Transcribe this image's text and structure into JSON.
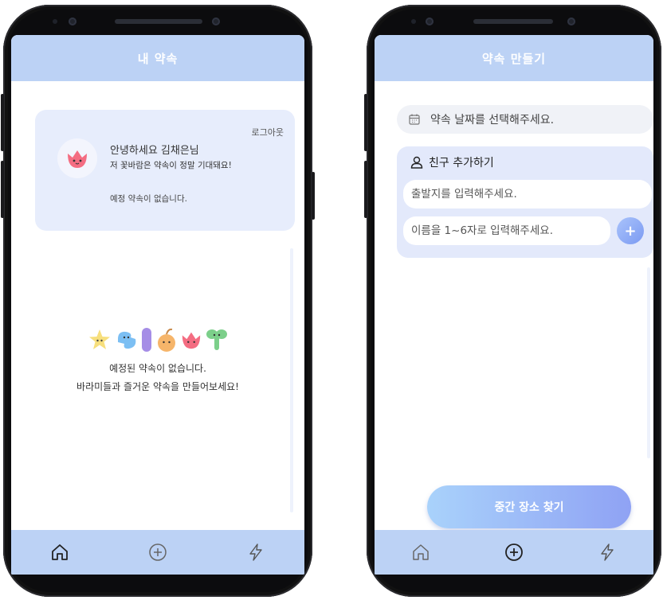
{
  "colors": {
    "header": "#bcd2f5",
    "card": "#e7edfc",
    "accent": "#8fa2f4",
    "phone_body": "#0c0c0e"
  },
  "home": {
    "title": "내 약속",
    "logout": "로그아웃",
    "greeting": "안녕하세요 김채은님",
    "greeting_sub": "저 꽃바람은 약속이 정말 기대돼요!",
    "no_appointment": "예정 약속이 없습니다.",
    "empty_line1": "예정된 약속이 없습니다.",
    "empty_line2": "바라미들과 즐거운 약속을 만들어보세요!",
    "nav": [
      "home-icon",
      "plus-circle-icon",
      "lightning-icon"
    ]
  },
  "create": {
    "title": "약속 만들기",
    "date_placeholder": "약속 날짜를 선택해주세요.",
    "add_friend": "친구 추가하기",
    "departure_placeholder": "출발지를 입력해주세요.",
    "name_placeholder": "이름을 1~6자로 입력해주세요.",
    "plus_label": "+",
    "find_button": "중간 장소 찾기",
    "nav": [
      "home-icon",
      "plus-circle-icon",
      "lightning-icon"
    ]
  }
}
